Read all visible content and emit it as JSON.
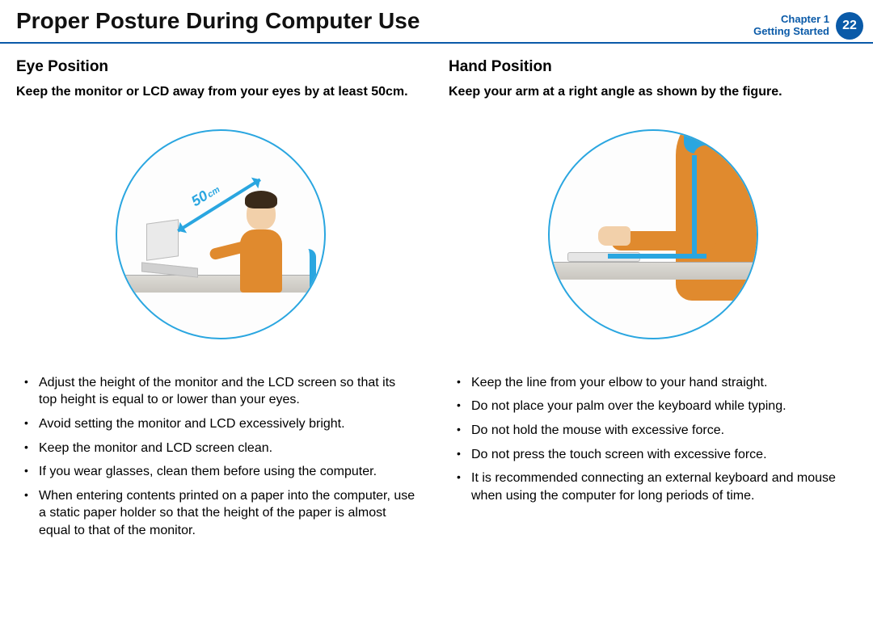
{
  "header": {
    "title": "Proper Posture During Computer Use",
    "chapter_line1": "Chapter 1",
    "chapter_line2": "Getting Started",
    "page_number": "22"
  },
  "eye": {
    "heading": "Eye Position",
    "sub": "Keep the monitor or LCD away from your eyes by at least 50cm.",
    "distance_value": "50",
    "distance_unit": "cm",
    "tips": [
      "Adjust the height of the monitor and the LCD screen so that its top height is equal to or lower than your eyes.",
      "Avoid setting the monitor and LCD excessively bright.",
      "Keep the monitor and LCD screen clean.",
      "If you wear glasses, clean them before using the computer.",
      "When entering contents printed on a paper into the computer, use a static paper holder so that the height of the paper is almost equal to that of the monitor."
    ]
  },
  "hand": {
    "heading": "Hand Position",
    "sub": "Keep your arm at a right angle as shown by the figure.",
    "tips": [
      "Keep the line from your elbow to your hand straight.",
      "Do not place your palm over the keyboard while typing.",
      "Do not hold the mouse with excessive force.",
      "Do not press the touch screen with excessive force.",
      "It is recommended connecting an external keyboard and mouse when using the computer for long periods of time."
    ]
  }
}
